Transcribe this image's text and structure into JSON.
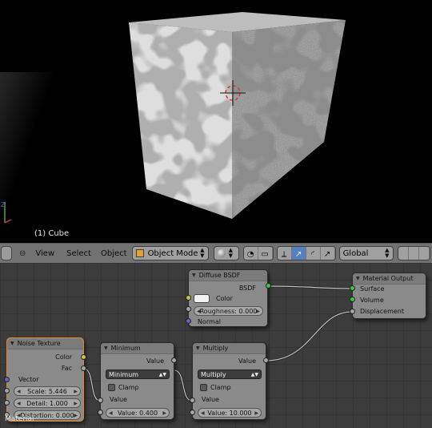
{
  "viewport": {
    "object_label": "(1) Cube",
    "axis_label": "Z"
  },
  "header": {
    "menus": [
      "View",
      "Select",
      "Object"
    ],
    "mode": "Object Mode",
    "orientation": "Global"
  },
  "node_editor": {
    "label": "Material",
    "nodes": {
      "noise": {
        "title": "Noise Texture",
        "outputs": [
          "Color",
          "Fac"
        ],
        "input": "Vector",
        "fields": [
          "Scale: 5.446",
          "Detail: 1.000",
          "Distortion: 0.000"
        ]
      },
      "minimum": {
        "title": "Minimum",
        "output": "Value",
        "operation": "Minimum",
        "clamp": "Clamp",
        "input": "Value",
        "field": "Value: 0.400"
      },
      "multiply": {
        "title": "Multiply",
        "output": "Value",
        "operation": "Multiply",
        "clamp": "Clamp",
        "input": "Value",
        "field": "Value: 10.000"
      },
      "diffuse": {
        "title": "Diffuse BSDF",
        "output": "BSDF",
        "color_label": "Color",
        "field": "Roughness: 0.000",
        "input": "Normal"
      },
      "output": {
        "title": "Material Output",
        "inputs": [
          "Surface",
          "Volume",
          "Displacement"
        ]
      }
    }
  },
  "colors": {
    "socket_shader": "#3ac83a",
    "socket_value": "#a5a5a5",
    "socket_color": "#c8c83a",
    "socket_vector": "#6363c7",
    "selected_outline": "#e08a2a",
    "active_icon": "#5680c2"
  }
}
